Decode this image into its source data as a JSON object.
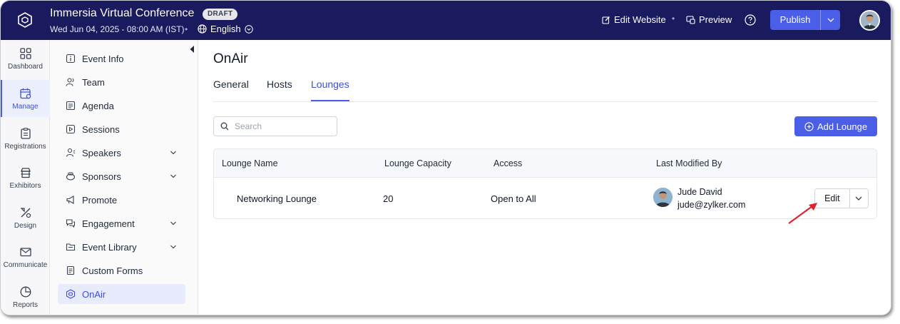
{
  "header": {
    "event_title": "Immersia Virtual Conference",
    "draft_badge": "DRAFT",
    "event_date": "Wed Jun 04, 2025 - 08:00 AM (IST)",
    "separator": "•",
    "language": "English",
    "edit_website": "Edit Website",
    "preview": "Preview",
    "publish": "Publish"
  },
  "rail": {
    "items": [
      {
        "label": "Dashboard",
        "icon": "grid-icon"
      },
      {
        "label": "Manage",
        "icon": "calendar-gear-icon",
        "active": true
      },
      {
        "label": "Registrations",
        "icon": "clipboard-icon"
      },
      {
        "label": "Exhibitors",
        "icon": "booth-icon"
      },
      {
        "label": "Design",
        "icon": "design-tools-icon"
      },
      {
        "label": "Communicate",
        "icon": "envelope-icon"
      },
      {
        "label": "Reports",
        "icon": "pie-chart-icon"
      }
    ]
  },
  "sidebar": {
    "items": [
      {
        "label": "Event Info"
      },
      {
        "label": "Team"
      },
      {
        "label": "Agenda"
      },
      {
        "label": "Sessions"
      },
      {
        "label": "Speakers",
        "expandable": true
      },
      {
        "label": "Sponsors",
        "expandable": true
      },
      {
        "label": "Promote"
      },
      {
        "label": "Engagement",
        "expandable": true
      },
      {
        "label": "Event Library",
        "expandable": true
      },
      {
        "label": "Custom Forms"
      },
      {
        "label": "OnAir",
        "active": true
      }
    ]
  },
  "main": {
    "title": "OnAir",
    "tabs": [
      {
        "label": "General"
      },
      {
        "label": "Hosts"
      },
      {
        "label": "Lounges",
        "active": true
      }
    ],
    "search_placeholder": "Search",
    "add_button": "Add Lounge",
    "table": {
      "columns": [
        "Lounge Name",
        "Lounge Capacity",
        "Access",
        "Last Modified By"
      ],
      "rows": [
        {
          "name": "Networking Lounge",
          "capacity": "20",
          "access": "Open to All",
          "modified_by_name": "Jude David",
          "modified_by_email": "jude@zylker.com",
          "action": "Edit"
        }
      ]
    }
  },
  "colors": {
    "header_bg": "#1a1a5e",
    "accent": "#4b5ee8",
    "annotation_arrow": "#e0242c"
  }
}
